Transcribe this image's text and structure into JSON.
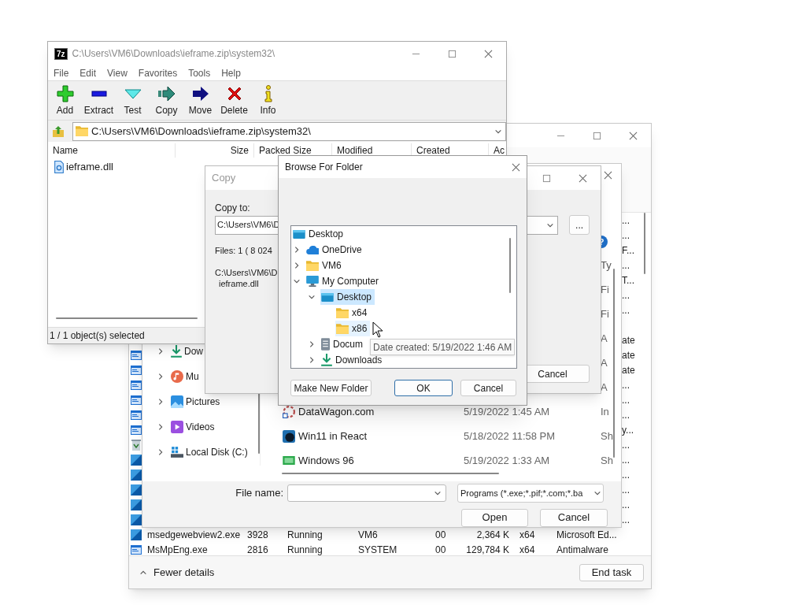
{
  "task_manager": {
    "rows": [
      {
        "tail": "..."
      },
      {
        "tail": "..."
      },
      {
        "tail": "F..."
      },
      {
        "tail": "..."
      },
      {
        "tail": "T..."
      },
      {
        "tail": "..."
      },
      {
        "tail": "..."
      },
      {
        "kind": "blank"
      },
      {
        "tail": "ate"
      },
      {
        "kind": "window",
        "tail": "ate"
      },
      {
        "kind": "window",
        "tail": "ate"
      },
      {
        "kind": "window",
        "tail": "..."
      },
      {
        "kind": "window",
        "tail": "..."
      },
      {
        "kind": "window",
        "tail": "..."
      },
      {
        "kind": "window",
        "tail": "y..."
      },
      {
        "kind": "bin",
        "tail": "..."
      },
      {
        "kind": "edge",
        "tail": "..."
      },
      {
        "kind": "edge",
        "tail": "..."
      },
      {
        "kind": "edge",
        "tail": "..."
      },
      {
        "kind": "edge",
        "tail": "..."
      },
      {
        "kind": "edge",
        "tail": "..."
      },
      {
        "kind": "edge",
        "name": "msedgewebview2.exe",
        "pid": "3928",
        "status": "Running",
        "user": "VM6",
        "cpu": "00",
        "memory": "2,364 K",
        "arch": "x64",
        "tail": "Microsoft Ed..."
      },
      {
        "kind": "window",
        "name": "MsMpEng.exe",
        "pid": "2816",
        "status": "Running",
        "user": "SYSTEM",
        "cpu": "00",
        "memory": "129,784 K",
        "arch": "x64",
        "tail": "Antimalware"
      }
    ],
    "fewer_details": "Fewer details",
    "end_task": "End task"
  },
  "open_dialog": {
    "help_glyph": "?",
    "nav_items": [
      {
        "label": "Dow",
        "kind": "downloads"
      },
      {
        "label": "Mu",
        "kind": "music"
      },
      {
        "label": "Pictures",
        "kind": "pictures"
      },
      {
        "label": "Videos",
        "kind": "videos"
      },
      {
        "label": "Local Disk (C:)",
        "kind": "disk"
      }
    ],
    "type_header": "Ty",
    "files": [
      {
        "type": "Fi"
      },
      {
        "type": "Fi"
      },
      {
        "type": "A"
      },
      {
        "type": "A"
      },
      {
        "type": "A"
      },
      {
        "kind": "swirl",
        "name": "DataWagon.com",
        "modified": "5/19/2022 1:45 AM",
        "type": "In"
      },
      {
        "kind": "react",
        "name": "Win11 in React",
        "modified": "5/18/2022 11:58 PM",
        "type": "Sh"
      },
      {
        "kind": "green",
        "name": "Windows 96",
        "modified": "5/19/2022 1:33 AM",
        "type": "Sh"
      }
    ],
    "file_name_label": "File name:",
    "file_type": "Programs (*.exe;*.pif;*.com;*.ba",
    "open": "Open",
    "cancel": "Cancel"
  },
  "sevenzip": {
    "logo": "7z",
    "title": "C:\\Users\\VM6\\Downloads\\ieframe.zip\\system32\\",
    "menu": [
      "File",
      "Edit",
      "View",
      "Favorites",
      "Tools",
      "Help"
    ],
    "toolbar": [
      {
        "kind": "add",
        "label": "Add"
      },
      {
        "kind": "extract",
        "label": "Extract"
      },
      {
        "kind": "test",
        "label": "Test"
      },
      {
        "kind": "copy",
        "label": "Copy"
      },
      {
        "kind": "move",
        "label": "Move"
      },
      {
        "kind": "delete",
        "label": "Delete"
      },
      {
        "kind": "info",
        "label": "Info"
      }
    ],
    "address": "C:\\Users\\VM6\\Downloads\\ieframe.zip\\system32\\",
    "columns": [
      "Name",
      "Size",
      "Packed Size",
      "Modified",
      "Created",
      "Ac"
    ],
    "rows": [
      {
        "name": "ieframe.dll"
      }
    ],
    "status": "1 / 1 object(s) selected"
  },
  "copy_dialog": {
    "title": "Copy",
    "copy_to_label": "Copy to:",
    "copy_to": "C:\\Users\\VM6\\D",
    "browse": "...",
    "files": "Files: 1 ( 8 024",
    "source_path": "C:\\Users\\VM6\\D",
    "source_file": "ieframe.dll",
    "cancel": "Cancel"
  },
  "browse_dialog": {
    "title": "Browse For Folder",
    "tree": [
      {
        "label": "Desktop",
        "kind": "desktop",
        "selected": false,
        "hovered": false,
        "children": [
          {
            "label": "OneDrive",
            "kind": "onedrive",
            "expanded": false,
            "selected": false,
            "hovered": false
          },
          {
            "label": "VM6",
            "kind": "folder",
            "expanded": false,
            "selected": false,
            "hovered": false
          },
          {
            "label": "My Computer",
            "kind": "computer",
            "expanded": true,
            "selected": false,
            "hovered": false,
            "children": [
              {
                "label": "Desktop",
                "kind": "desktop",
                "expanded": true,
                "selected": true,
                "hovered": false,
                "children": [
                  {
                    "label": "x64",
                    "kind": "folder",
                    "selected": false,
                    "hovered": false
                  },
                  {
                    "label": "x86",
                    "kind": "folder",
                    "selected": false,
                    "hovered": true
                  }
                ]
              },
              {
                "label": "Docum",
                "kind": "documents",
                "expanded": false,
                "selected": false,
                "hovered": false
              },
              {
                "label": "Downloads",
                "kind": "downloads",
                "expanded": false,
                "selected": false,
                "hovered": false
              }
            ]
          }
        ]
      }
    ],
    "make_new_folder": "Make New Folder",
    "ok": "OK",
    "cancel": "Cancel",
    "tooltip": "Date created: 5/19/2022 1:46 AM"
  }
}
